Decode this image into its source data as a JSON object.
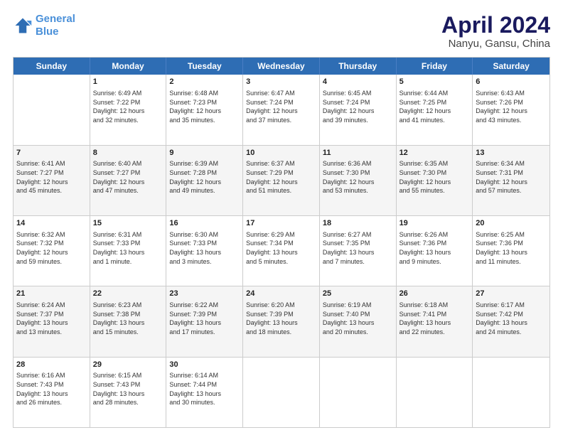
{
  "logo": {
    "line1": "General",
    "line2": "Blue"
  },
  "title": "April 2024",
  "subtitle": "Nanyu, Gansu, China",
  "headers": [
    "Sunday",
    "Monday",
    "Tuesday",
    "Wednesday",
    "Thursday",
    "Friday",
    "Saturday"
  ],
  "rows": [
    [
      {
        "day": "",
        "info": ""
      },
      {
        "day": "1",
        "info": "Sunrise: 6:49 AM\nSunset: 7:22 PM\nDaylight: 12 hours\nand 32 minutes."
      },
      {
        "day": "2",
        "info": "Sunrise: 6:48 AM\nSunset: 7:23 PM\nDaylight: 12 hours\nand 35 minutes."
      },
      {
        "day": "3",
        "info": "Sunrise: 6:47 AM\nSunset: 7:24 PM\nDaylight: 12 hours\nand 37 minutes."
      },
      {
        "day": "4",
        "info": "Sunrise: 6:45 AM\nSunset: 7:24 PM\nDaylight: 12 hours\nand 39 minutes."
      },
      {
        "day": "5",
        "info": "Sunrise: 6:44 AM\nSunset: 7:25 PM\nDaylight: 12 hours\nand 41 minutes."
      },
      {
        "day": "6",
        "info": "Sunrise: 6:43 AM\nSunset: 7:26 PM\nDaylight: 12 hours\nand 43 minutes."
      }
    ],
    [
      {
        "day": "7",
        "info": "Sunrise: 6:41 AM\nSunset: 7:27 PM\nDaylight: 12 hours\nand 45 minutes."
      },
      {
        "day": "8",
        "info": "Sunrise: 6:40 AM\nSunset: 7:27 PM\nDaylight: 12 hours\nand 47 minutes."
      },
      {
        "day": "9",
        "info": "Sunrise: 6:39 AM\nSunset: 7:28 PM\nDaylight: 12 hours\nand 49 minutes."
      },
      {
        "day": "10",
        "info": "Sunrise: 6:37 AM\nSunset: 7:29 PM\nDaylight: 12 hours\nand 51 minutes."
      },
      {
        "day": "11",
        "info": "Sunrise: 6:36 AM\nSunset: 7:30 PM\nDaylight: 12 hours\nand 53 minutes."
      },
      {
        "day": "12",
        "info": "Sunrise: 6:35 AM\nSunset: 7:30 PM\nDaylight: 12 hours\nand 55 minutes."
      },
      {
        "day": "13",
        "info": "Sunrise: 6:34 AM\nSunset: 7:31 PM\nDaylight: 12 hours\nand 57 minutes."
      }
    ],
    [
      {
        "day": "14",
        "info": "Sunrise: 6:32 AM\nSunset: 7:32 PM\nDaylight: 12 hours\nand 59 minutes."
      },
      {
        "day": "15",
        "info": "Sunrise: 6:31 AM\nSunset: 7:33 PM\nDaylight: 13 hours\nand 1 minute."
      },
      {
        "day": "16",
        "info": "Sunrise: 6:30 AM\nSunset: 7:33 PM\nDaylight: 13 hours\nand 3 minutes."
      },
      {
        "day": "17",
        "info": "Sunrise: 6:29 AM\nSunset: 7:34 PM\nDaylight: 13 hours\nand 5 minutes."
      },
      {
        "day": "18",
        "info": "Sunrise: 6:27 AM\nSunset: 7:35 PM\nDaylight: 13 hours\nand 7 minutes."
      },
      {
        "day": "19",
        "info": "Sunrise: 6:26 AM\nSunset: 7:36 PM\nDaylight: 13 hours\nand 9 minutes."
      },
      {
        "day": "20",
        "info": "Sunrise: 6:25 AM\nSunset: 7:36 PM\nDaylight: 13 hours\nand 11 minutes."
      }
    ],
    [
      {
        "day": "21",
        "info": "Sunrise: 6:24 AM\nSunset: 7:37 PM\nDaylight: 13 hours\nand 13 minutes."
      },
      {
        "day": "22",
        "info": "Sunrise: 6:23 AM\nSunset: 7:38 PM\nDaylight: 13 hours\nand 15 minutes."
      },
      {
        "day": "23",
        "info": "Sunrise: 6:22 AM\nSunset: 7:39 PM\nDaylight: 13 hours\nand 17 minutes."
      },
      {
        "day": "24",
        "info": "Sunrise: 6:20 AM\nSunset: 7:39 PM\nDaylight: 13 hours\nand 18 minutes."
      },
      {
        "day": "25",
        "info": "Sunrise: 6:19 AM\nSunset: 7:40 PM\nDaylight: 13 hours\nand 20 minutes."
      },
      {
        "day": "26",
        "info": "Sunrise: 6:18 AM\nSunset: 7:41 PM\nDaylight: 13 hours\nand 22 minutes."
      },
      {
        "day": "27",
        "info": "Sunrise: 6:17 AM\nSunset: 7:42 PM\nDaylight: 13 hours\nand 24 minutes."
      }
    ],
    [
      {
        "day": "28",
        "info": "Sunrise: 6:16 AM\nSunset: 7:43 PM\nDaylight: 13 hours\nand 26 minutes."
      },
      {
        "day": "29",
        "info": "Sunrise: 6:15 AM\nSunset: 7:43 PM\nDaylight: 13 hours\nand 28 minutes."
      },
      {
        "day": "30",
        "info": "Sunrise: 6:14 AM\nSunset: 7:44 PM\nDaylight: 13 hours\nand 30 minutes."
      },
      {
        "day": "",
        "info": ""
      },
      {
        "day": "",
        "info": ""
      },
      {
        "day": "",
        "info": ""
      },
      {
        "day": "",
        "info": ""
      }
    ]
  ]
}
